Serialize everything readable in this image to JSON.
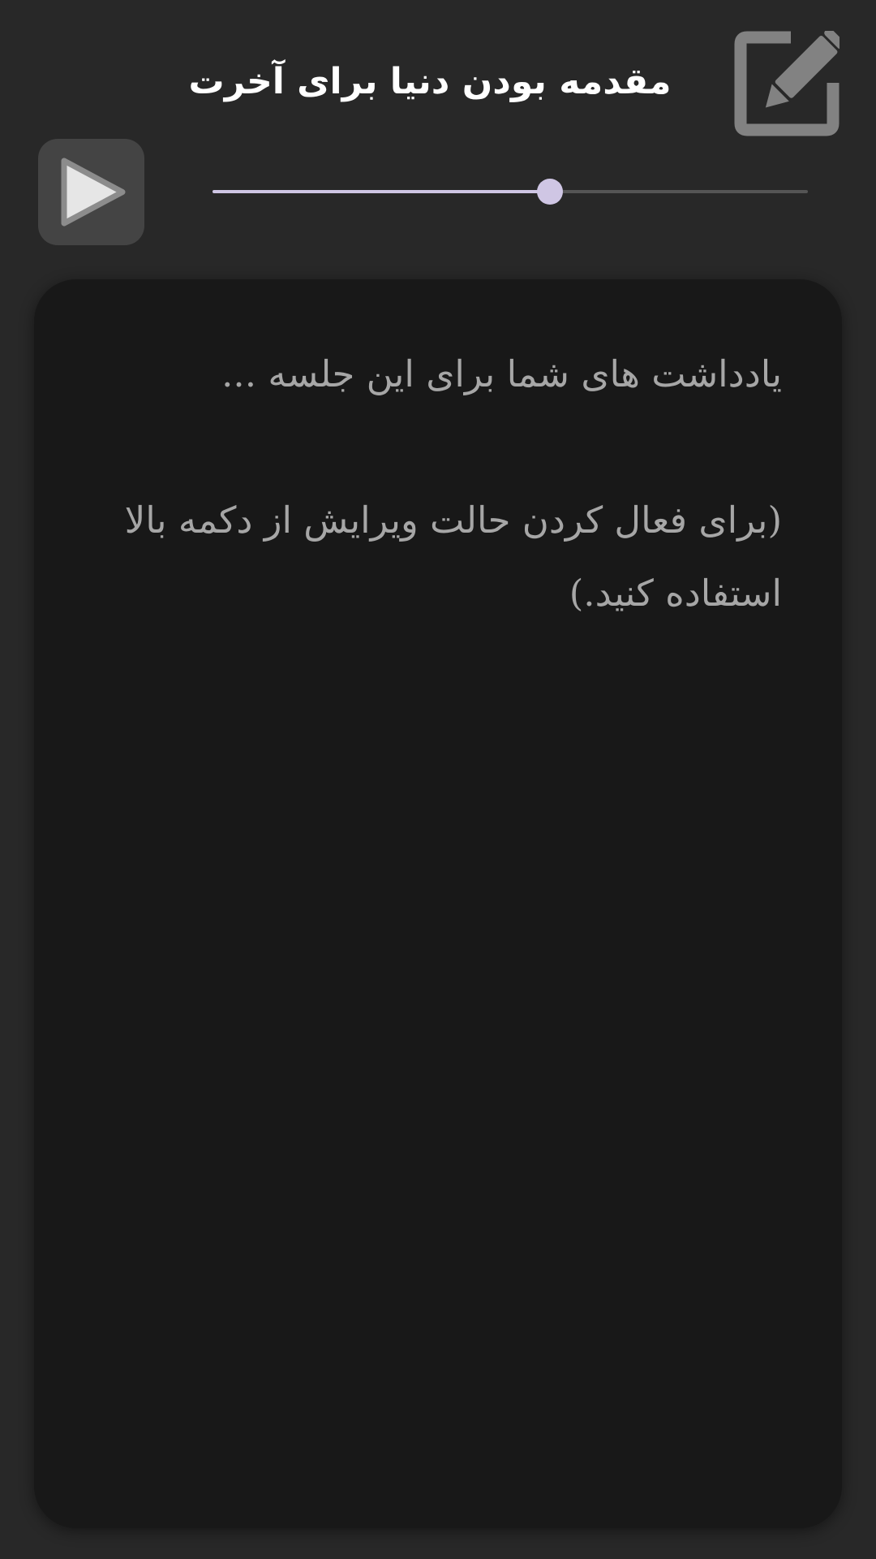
{
  "header": {
    "title": "مقدمه بودن دنیا برای آخرت",
    "edit_icon": "edit-pencil-icon"
  },
  "player": {
    "play_icon": "play-icon",
    "progress": 0.567,
    "accent_color": "#cfc6e4"
  },
  "notes": {
    "placeholder_line1": "یادداشت های شما برای این جلسه ...",
    "placeholder_line2": "(برای فعال کردن حالت ویرایش از دکمه بالا استفاده کنید.)"
  },
  "colors": {
    "background": "#282828",
    "panel": "#181818",
    "placeholder_text": "#a6a6a6",
    "icon_gray": "#828282"
  }
}
